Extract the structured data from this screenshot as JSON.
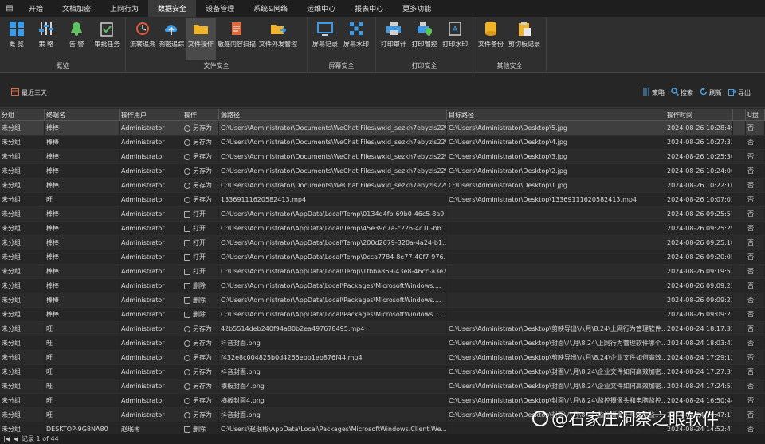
{
  "menu": {
    "tabs": [
      "开始",
      "文档加密",
      "上网行为",
      "数据安全",
      "设备管理",
      "系统&网络",
      "运维中心",
      "报表中心",
      "更多功能"
    ],
    "active_index": 3
  },
  "ribbon": {
    "groups": [
      {
        "label": "概览",
        "buttons": [
          "概 览",
          "策 略",
          "告 警",
          "审批任务"
        ]
      },
      {
        "label": "文件安全",
        "buttons": [
          "流转追溯",
          "溯密追踪",
          "文件操作",
          "敏感内容扫描",
          "文件外发管控"
        ]
      },
      {
        "label": "屏幕安全",
        "buttons": [
          "屏幕记录",
          "屏幕水印"
        ]
      },
      {
        "label": "打印安全",
        "buttons": [
          "打印审计",
          "打印管控",
          "打印水印"
        ]
      },
      {
        "label": "其他安全",
        "buttons": [
          "文件备份",
          "剪切板记录"
        ]
      }
    ],
    "active_button": "文件操作"
  },
  "toolbar": {
    "range_label": "最近三天",
    "policy_label": "策略",
    "search_label": "搜索",
    "refresh_label": "刷新",
    "export_label": "导出"
  },
  "table": {
    "columns": [
      "分组",
      "终端名",
      "操作用户",
      "操作",
      "源路径",
      "目标路径",
      "操作时间",
      "",
      "U盘"
    ],
    "rows": [
      [
        "未分组",
        "棒棒",
        "Administrator",
        "另存为",
        "C:\\Users\\Administrator\\Documents\\WeChat Files\\wxid_sezkh7ebyzls22\\...",
        "C:\\Users\\Administrator\\Desktop\\5.jpg",
        "2024-08-26 10:28:49",
        "",
        "否"
      ],
      [
        "未分组",
        "棒棒",
        "Administrator",
        "另存为",
        "C:\\Users\\Administrator\\Documents\\WeChat Files\\wxid_sezkh7ebyzls22\\...",
        "C:\\Users\\Administrator\\Desktop\\4.jpg",
        "2024-08-26 10:27:32",
        "",
        "否"
      ],
      [
        "未分组",
        "棒棒",
        "Administrator",
        "另存为",
        "C:\\Users\\Administrator\\Documents\\WeChat Files\\wxid_sezkh7ebyzls22\\...",
        "C:\\Users\\Administrator\\Desktop\\3.jpg",
        "2024-08-26 10:25:36",
        "",
        "否"
      ],
      [
        "未分组",
        "棒棒",
        "Administrator",
        "另存为",
        "C:\\Users\\Administrator\\Documents\\WeChat Files\\wxid_sezkh7ebyzls22\\...",
        "C:\\Users\\Administrator\\Desktop\\2.jpg",
        "2024-08-26 10:24:06",
        "",
        "否"
      ],
      [
        "未分组",
        "棒棒",
        "Administrator",
        "另存为",
        "C:\\Users\\Administrator\\Documents\\WeChat Files\\wxid_sezkh7ebyzls22\\...",
        "C:\\Users\\Administrator\\Desktop\\1.jpg",
        "2024-08-26 10:22:10",
        "",
        "否"
      ],
      [
        "未分组",
        "旺",
        "Administrator",
        "另存为",
        "13369111620582413.mp4",
        "C:\\Users\\Administrator\\Desktop\\13369111620582413.mp4",
        "2024-08-26 10:07:03",
        "",
        "否"
      ],
      [
        "未分组",
        "棒棒",
        "Administrator",
        "打开",
        "C:\\Users\\Administrator\\AppData\\Local\\Temp\\0134d4fb-69b0-46c5-8a9...",
        "",
        "2024-08-26 09:25:57",
        "",
        "否"
      ],
      [
        "未分组",
        "棒棒",
        "Administrator",
        "打开",
        "C:\\Users\\Administrator\\AppData\\Local\\Temp\\45e39d7a-c226-4c10-bb...",
        "",
        "2024-08-26 09:25:29",
        "",
        "否"
      ],
      [
        "未分组",
        "棒棒",
        "Administrator",
        "打开",
        "C:\\Users\\Administrator\\AppData\\Local\\Temp\\200d2679-320a-4a24-b1...",
        "",
        "2024-08-26 09:25:18",
        "",
        "否"
      ],
      [
        "未分组",
        "棒棒",
        "Administrator",
        "打开",
        "C:\\Users\\Administrator\\AppData\\Local\\Temp\\0cca7784-8e77-40f7-976...",
        "",
        "2024-08-26 09:20:05",
        "",
        "否"
      ],
      [
        "未分组",
        "棒棒",
        "Administrator",
        "打开",
        "C:\\Users\\Administrator\\AppData\\Local\\Temp\\1fbba869-43e8-46cc-a3e2...",
        "",
        "2024-08-26 09:19:53",
        "",
        "否"
      ],
      [
        "未分组",
        "棒棒",
        "Administrator",
        "删除",
        "C:\\Users\\Administrator\\AppData\\Local\\Packages\\MicrosoftWindows....",
        "",
        "2024-08-26 09:09:22",
        "",
        "否"
      ],
      [
        "未分组",
        "棒棒",
        "Administrator",
        "删除",
        "C:\\Users\\Administrator\\AppData\\Local\\Packages\\MicrosoftWindows....",
        "",
        "2024-08-26 09:09:22",
        "",
        "否"
      ],
      [
        "未分组",
        "棒棒",
        "Administrator",
        "删除",
        "C:\\Users\\Administrator\\AppData\\Local\\Packages\\MicrosoftWindows....",
        "",
        "2024-08-26 09:09:22",
        "",
        "否"
      ],
      [
        "未分组",
        "旺",
        "Administrator",
        "另存为",
        "42b5514deb240f94a80b2ea497678495.mp4",
        "C:\\Users\\Administrator\\Desktop\\剪映导出\\八月\\8.24\\上网行为管理软件...",
        "2024-08-24 18:17:32",
        "",
        "否"
      ],
      [
        "未分组",
        "旺",
        "Administrator",
        "另存为",
        "抖音封面.png",
        "C:\\Users\\Administrator\\Desktop\\封面\\八月\\8.24\\上网行为管理软件哪个...",
        "2024-08-24 18:03:42",
        "",
        "否"
      ],
      [
        "未分组",
        "旺",
        "Administrator",
        "另存为",
        "f432e8c004825b0d4266ebb1eb876f44.mp4",
        "C:\\Users\\Administrator\\Desktop\\剪映导出\\八月\\8.24\\企业文件如何高效...",
        "2024-08-24 17:29:12",
        "",
        "否"
      ],
      [
        "未分组",
        "旺",
        "Administrator",
        "另存为",
        "抖音封面.png",
        "C:\\Users\\Administrator\\Desktop\\封面\\八月\\8.24\\企业文件如何高效加密...",
        "2024-08-24 17:27:39",
        "",
        "否"
      ],
      [
        "未分组",
        "旺",
        "Administrator",
        "另存为",
        "横板封面4.png",
        "C:\\Users\\Administrator\\Desktop\\封面\\八月\\8.24\\企业文件如何高效加密...",
        "2024-08-24 17:24:53",
        "",
        "否"
      ],
      [
        "未分组",
        "旺",
        "Administrator",
        "另存为",
        "横板封面4.png",
        "C:\\Users\\Administrator\\Desktop\\封面\\八月\\8.24\\监控摄像头和电脑监控...",
        "2024-08-24 16:50:44",
        "",
        "否"
      ],
      [
        "未分组",
        "旺",
        "Administrator",
        "另存为",
        "抖音封面.png",
        "C:\\Users\\Administrator\\Desktop\\封面\\八月\\8.24\\监控摄像头和电脑监...",
        "2024-08-24 16:47:17",
        "",
        "否"
      ],
      [
        "未分组",
        "DESKTOP-9G8NA80",
        "赵珉彬",
        "删除",
        "C:\\Users\\赵珉彬\\AppData\\Local\\Packages\\MicrosoftWindows.Client.We...",
        "",
        "2024-08-24 14:52:47",
        "",
        "否"
      ]
    ]
  },
  "status": {
    "records": "记录 1 of 44"
  },
  "watermark": {
    "text": "@石家庄洞察之眼软件"
  },
  "colors": {
    "accent": "#2d8fe0",
    "toolbar_icon": "#4aa3e8"
  }
}
